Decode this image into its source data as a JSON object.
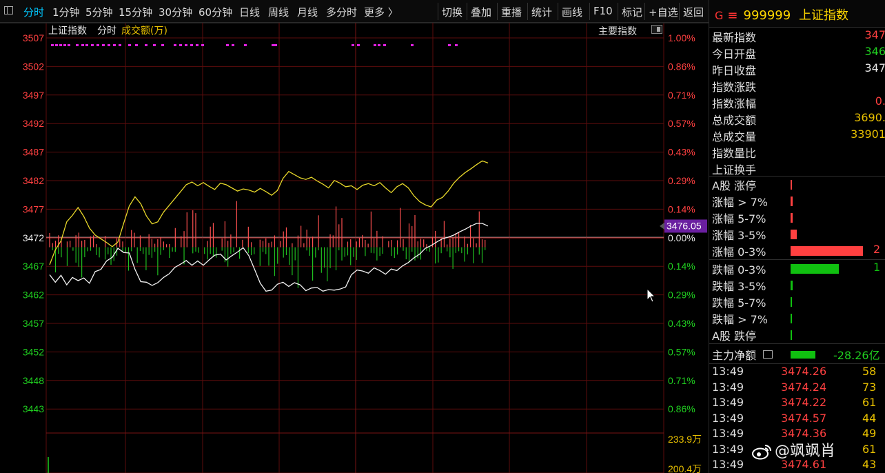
{
  "toolbar": {
    "periods": [
      "分时",
      "1分钟",
      "5分钟",
      "15分钟",
      "30分钟",
      "60分钟",
      "日线",
      "周线",
      "月线",
      "多分时",
      "更多 〉"
    ],
    "active_period": "分时",
    "actions": [
      "切换",
      "叠加",
      "重播",
      "统计",
      "画线",
      "F10",
      "标记",
      "+自选",
      "返回"
    ]
  },
  "chart_header": {
    "name": "上证指数",
    "mode": "分时",
    "volume_label": "成交额(万)",
    "main_index_button": "主要指数"
  },
  "chart_data": {
    "type": "line",
    "prev_close": 3472,
    "ylim": [
      3438.5,
      3511.5
    ],
    "y_ticks_left": [
      "3507",
      "3502",
      "3497",
      "3492",
      "3487",
      "3482",
      "3477",
      "3472",
      "3467",
      "3462",
      "3457",
      "3452",
      "3448",
      "3443"
    ],
    "y_ticks_right": [
      "1.00%",
      "0.86%",
      "0.71%",
      "0.57%",
      "0.43%",
      "0.29%",
      "0.14%",
      "0.00%",
      "0.14%",
      "0.29%",
      "0.43%",
      "0.57%",
      "0.71%",
      "0.86%"
    ],
    "current_price_tag": "3476.05",
    "volume_ticks": [
      "233.9万",
      "200.4万"
    ],
    "series": [
      {
        "color": "#e8d82a",
        "values": [
          3468.7,
          3471.5,
          3473.2,
          3476.8,
          3478.0,
          3479.5,
          3477.8,
          3475.6,
          3474.3,
          3473.6,
          3472.9,
          3472.1,
          3473.0,
          3476.5,
          3479.8,
          3481.5,
          3480.2,
          3477.9,
          3476.4,
          3476.8,
          3478.6,
          3479.9,
          3481.2,
          3482.5,
          3483.8,
          3484.3,
          3483.6,
          3484.2,
          3483.5,
          3482.9,
          3484.1,
          3483.8,
          3483.2,
          3482.6,
          3483.0,
          3482.8,
          3482.4,
          3483.1,
          3482.5,
          3481.8,
          3482.7,
          3485.0,
          3486.3,
          3485.7,
          3485.1,
          3484.8,
          3485.2,
          3484.5,
          3483.9,
          3483.2,
          3484.6,
          3484.1,
          3483.4,
          3483.6,
          3482.9,
          3483.7,
          3484.0,
          3483.6,
          3484.2,
          3483.2,
          3482.3,
          3483.4,
          3484.0,
          3483.2,
          3481.7,
          3480.6,
          3480.0,
          3479.6,
          3480.9,
          3481.4,
          3482.6,
          3484.1,
          3485.2,
          3486.1,
          3486.8,
          3487.6,
          3488.3,
          3487.9
        ]
      },
      {
        "color": "#f2f2f2",
        "values": [
          3466.8,
          3465.4,
          3466.7,
          3464.9,
          3466.3,
          3465.7,
          3466.2,
          3465.2,
          3467.4,
          3467.8,
          3469.4,
          3470.1,
          3471.8,
          3471.0,
          3470.9,
          3467.8,
          3465.5,
          3465.4,
          3464.8,
          3465.3,
          3466.3,
          3467.0,
          3468.2,
          3468.8,
          3469.5,
          3468.6,
          3469.4,
          3468.6,
          3469.6,
          3470.5,
          3470.7,
          3469.6,
          3470.4,
          3471.1,
          3471.9,
          3470.4,
          3467.8,
          3465.2,
          3463.7,
          3463.9,
          3465.0,
          3465.4,
          3464.6,
          3465.3,
          3464.9,
          3463.8,
          3464.3,
          3464.4,
          3463.7,
          3464.0,
          3463.9,
          3464.1,
          3464.5,
          3466.8,
          3467.7,
          3467.5,
          3467.1,
          3468.1,
          3467.6,
          3466.9,
          3467.9,
          3467.6,
          3468.5,
          3469.1,
          3470.0,
          3470.7,
          3471.8,
          3472.3,
          3473.0,
          3473.6,
          3473.9,
          3474.3,
          3474.9,
          3475.4,
          3476.0,
          3476.5,
          3476.5,
          3476.0
        ]
      }
    ],
    "buy_dots": true
  },
  "right_panel": {
    "code": "999999",
    "name": "上证指数",
    "stats": [
      {
        "label": "最新指数",
        "value": "347",
        "color": "red"
      },
      {
        "label": "今日开盘",
        "value": "346",
        "color": "green"
      },
      {
        "label": "昨日收盘",
        "value": "347",
        "color": "white"
      },
      {
        "label": "指数涨跌",
        "value": "",
        "color": "red"
      },
      {
        "label": "指数涨幅",
        "value": "0.",
        "color": "red"
      },
      {
        "label": "总成交额",
        "value": "3690.",
        "color": "yellow"
      },
      {
        "label": "总成交量",
        "value": "33901",
        "color": "yellow"
      },
      {
        "label": "指数量比",
        "value": "",
        "color": "white"
      },
      {
        "label": "上证换手",
        "value": "",
        "color": "white"
      }
    ],
    "up_dist": [
      {
        "label": "A股 涨停",
        "frac": 0.01,
        "num": ""
      },
      {
        "label": "涨幅 > 7%",
        "frac": 0.02,
        "num": ""
      },
      {
        "label": "涨幅 5-7%",
        "frac": 0.02,
        "num": ""
      },
      {
        "label": "涨幅 3-5%",
        "frac": 0.05,
        "num": ""
      },
      {
        "label": "涨幅 0-3%",
        "frac": 0.62,
        "num": "2"
      }
    ],
    "down_dist": [
      {
        "label": "跌幅 0-3%",
        "frac": 0.41,
        "num": "1"
      },
      {
        "label": "跌幅 3-5%",
        "frac": 0.02,
        "num": ""
      },
      {
        "label": "跌幅 5-7%",
        "frac": 0.01,
        "num": ""
      },
      {
        "label": "跌幅 > 7%",
        "frac": 0.01,
        "num": ""
      },
      {
        "label": "A股 跌停",
        "frac": 0.01,
        "num": ""
      }
    ],
    "main_flow_label": "主力净额",
    "main_flow_value": "-28.26亿",
    "ticks": [
      {
        "time": "13:49",
        "price": "3474.26",
        "vol": "58"
      },
      {
        "time": "13:49",
        "price": "3474.24",
        "vol": "73"
      },
      {
        "time": "13:49",
        "price": "3474.22",
        "vol": "61"
      },
      {
        "time": "13:49",
        "price": "3474.57",
        "vol": "44"
      },
      {
        "time": "13:49",
        "price": "3474.36",
        "vol": "49"
      },
      {
        "time": "13:49",
        "price": "",
        "vol": "61"
      },
      {
        "time": "13:49",
        "price": "3474.61",
        "vol": "43"
      }
    ]
  },
  "watermark": "@飒飒肖",
  "colors": {
    "up": "#ff4040",
    "down": "#20d020",
    "grid": "#5c0c0c",
    "accent": "#00c8ff",
    "price_tag_bg": "#6a1fa0"
  }
}
